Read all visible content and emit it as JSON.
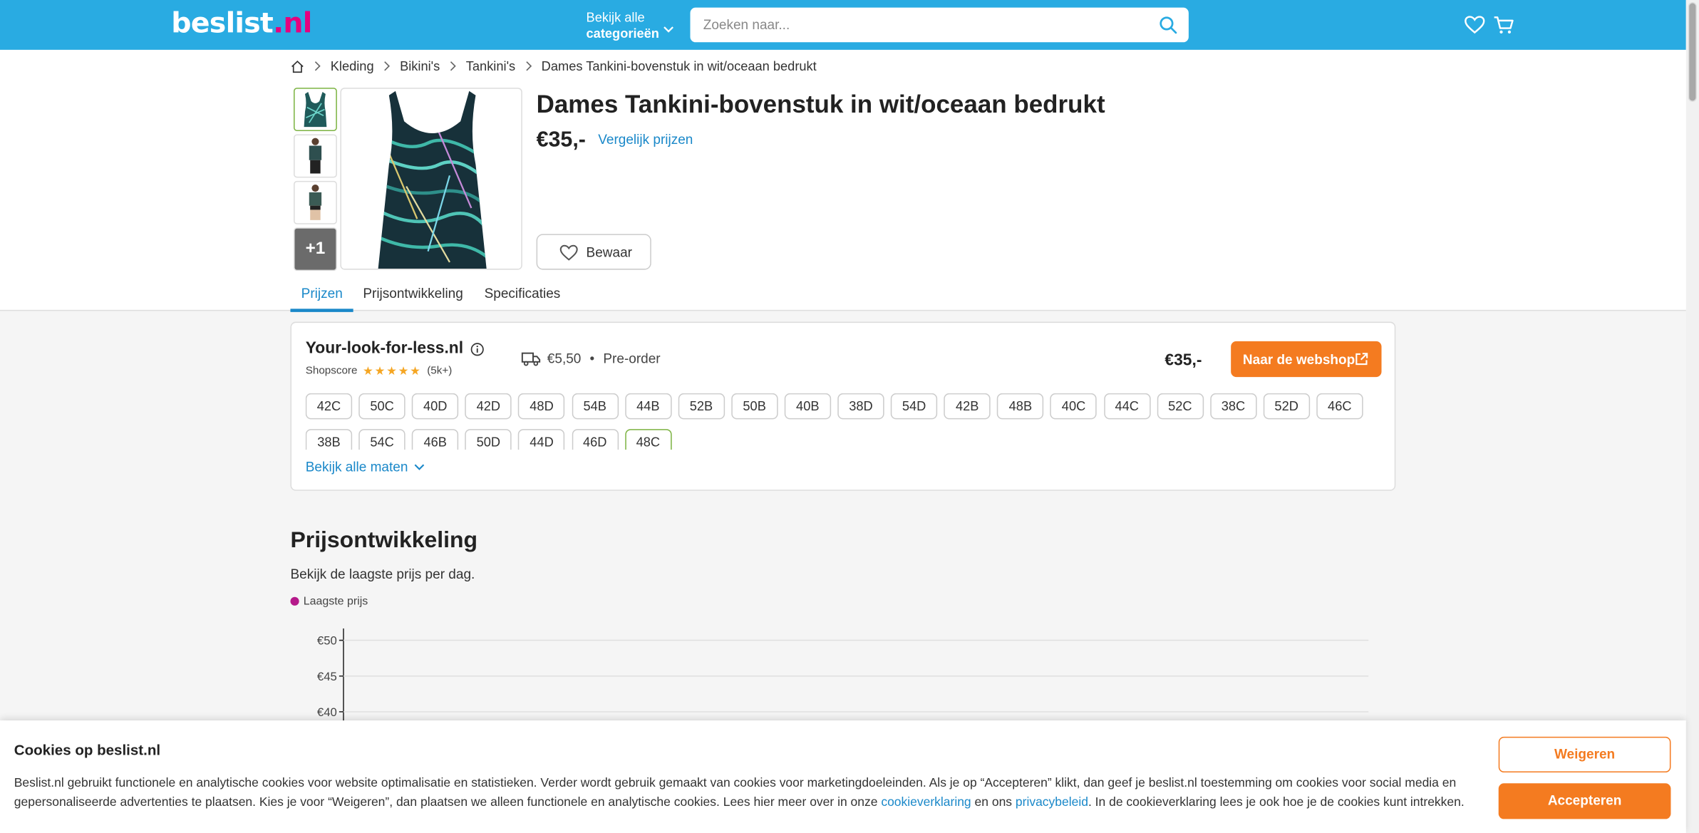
{
  "header": {
    "logo": {
      "text": "beslist",
      "suffix": ".nl"
    },
    "categories": {
      "line1": "Bekijk alle",
      "line2": "categorieën"
    },
    "search_placeholder": "Zoeken naar...",
    "icons": [
      "heart-icon",
      "cart-icon",
      "search-icon",
      "chevron-down-icon"
    ]
  },
  "breadcrumb": [
    "Kleding",
    "Bikini's",
    "Tankini's",
    "Dames Tankini-bovenstuk in wit/oceaan bedrukt"
  ],
  "product": {
    "title": "Dames Tankini-bovenstuk in wit/oceaan bedrukt",
    "price": "€35,-",
    "compare_link": "Vergelijk prijzen",
    "save_label": "Bewaar",
    "more_images": "+1"
  },
  "tabs": [
    "Prijzen",
    "Prijsontwikkeling",
    "Specificaties"
  ],
  "offer": {
    "shop": "Your-look-for-less.nl",
    "shopscore_label": "Shopscore",
    "stars": "★★★★★",
    "rating_fraction": 0.9,
    "reviews": "(5k+)",
    "shipping": "€5,50",
    "bullet": "•",
    "availability": "Pre-order",
    "price": "€35,-",
    "button": "Naar de webshop",
    "sizes": [
      "42C",
      "50C",
      "40D",
      "42D",
      "48D",
      "54B",
      "44B",
      "52B",
      "50B",
      "40B",
      "38D",
      "54D",
      "42B",
      "48B",
      "40C",
      "44C",
      "52C",
      "38C",
      "52D",
      "46C",
      "38B",
      "54C",
      "46B",
      "50D",
      "44D",
      "46D",
      "48C"
    ],
    "selected_size": "48C",
    "more_sizes": "Bekijk alle maten"
  },
  "price_history": {
    "title": "Prijsontwikkeling",
    "subtitle": "Bekijk de laagste prijs per dag.",
    "legend": "Laagste prijs",
    "legend_color": "#b5198a"
  },
  "chart_data": {
    "type": "line",
    "series": [
      {
        "name": "Laagste prijs",
        "values": []
      }
    ],
    "y_ticks": [
      "€50",
      "€45",
      "€40"
    ],
    "grid": true
  },
  "cookie": {
    "title": "Cookies op beslist.nl",
    "text_1": "Beslist.nl gebruikt functionele en analytische cookies voor website optimalisatie en statistieken. Verder wordt gebruik gemaakt van cookies voor marketingdoeleinden. Als je op “Accepteren” klikt, dan geef je beslist.nl toestemming om cookies voor social media en gepersonaliseerde advertenties te plaatsen. Kies je voor “Weigeren”, dan plaatsen we alleen functionele en analytische cookies. Lees hier meer over in onze ",
    "link_1": "cookieverklaring",
    "text_2": " en ons ",
    "link_2": "privacybeleid",
    "text_3": ". In de cookieverklaring lees je ook hoe je de cookies kunt intrekken.",
    "refuse": "Weigeren",
    "accept": "Accepteren"
  },
  "colors": {
    "header": "#29abe2",
    "accent": "#f47b20",
    "link": "#1a88c9",
    "selected": "#7cb342"
  }
}
